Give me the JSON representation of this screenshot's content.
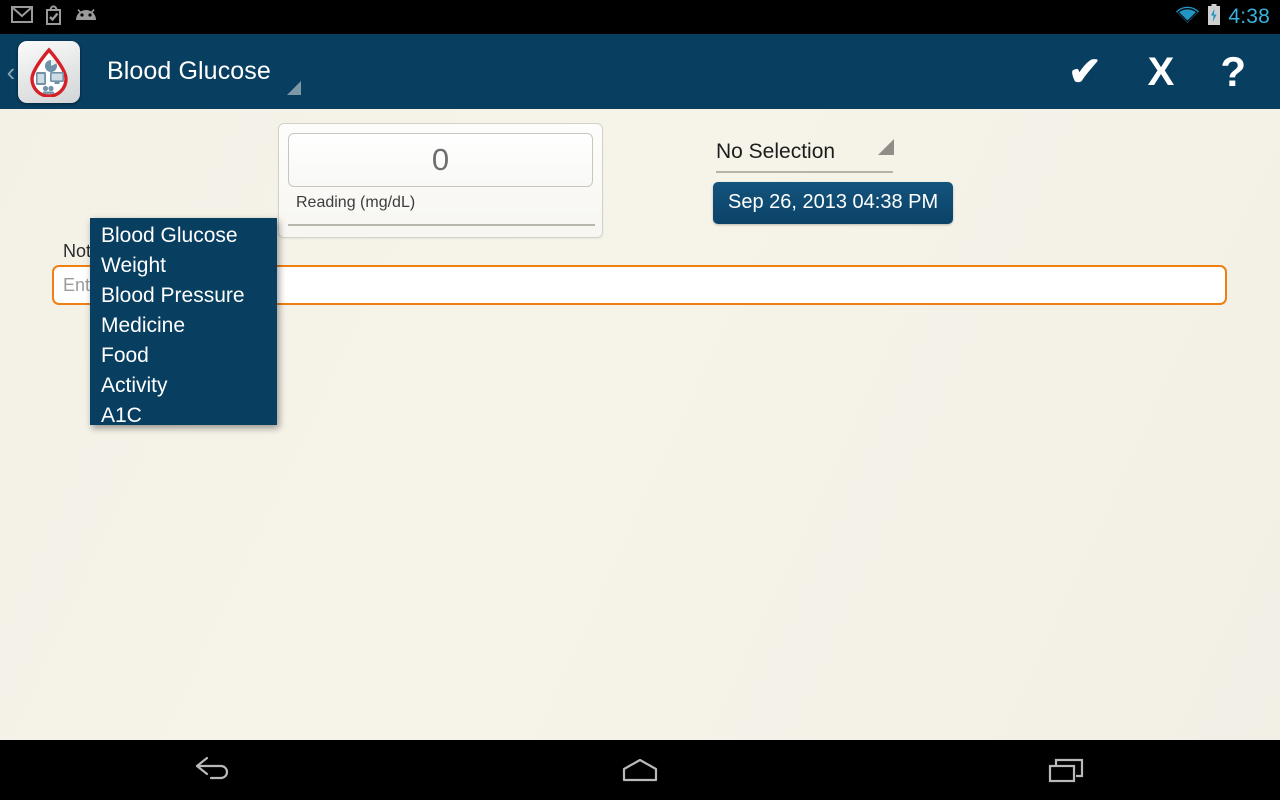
{
  "status_bar": {
    "time": "4:38",
    "icons": [
      "gmail-icon",
      "play-store-icon",
      "android-head-icon"
    ],
    "right_icons": [
      "wifi-icon",
      "battery-charging-icon"
    ]
  },
  "app_bar": {
    "back_label": "‹",
    "title": "Blood Glucose",
    "app_icon_name": "blood-drop-app-icon",
    "actions": {
      "confirm": "✔",
      "cancel": "X",
      "help": "?"
    }
  },
  "dropdown": {
    "open": true,
    "selected": "Blood Glucose",
    "items": [
      {
        "label": "Blood Glucose"
      },
      {
        "label": "Weight"
      },
      {
        "label": "Blood Pressure"
      },
      {
        "label": "Medicine"
      },
      {
        "label": "Food"
      },
      {
        "label": "Activity"
      },
      {
        "label": "A1C"
      }
    ]
  },
  "form": {
    "reading": {
      "value": "0",
      "placeholder": "0",
      "label": "Reading (mg/dL)"
    },
    "selection": {
      "value": "No Selection"
    },
    "date_button": {
      "label": "Sep 26, 2013 04:38 PM"
    },
    "notes": {
      "label": "Notes",
      "value": "",
      "placeholder": "Enter Notes"
    }
  },
  "nav_bar": {
    "buttons": [
      "back-nav-icon",
      "home-nav-icon",
      "recents-nav-icon"
    ]
  },
  "colors": {
    "header": "#083e60",
    "accent_orange": "#ef7f14",
    "background": "#f6f4e9",
    "status_time": "#3ab0dd"
  }
}
